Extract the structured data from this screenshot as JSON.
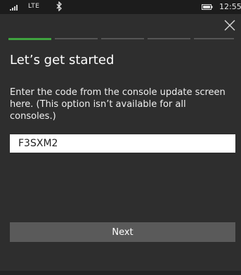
{
  "status_bar": {
    "network": "LTE",
    "time": "12:55",
    "icons": [
      "signal-icon",
      "bluetooth-icon",
      "battery-icon"
    ]
  },
  "header": {
    "close_icon": "close-icon"
  },
  "progress": {
    "total_steps": 5,
    "current_step": 1,
    "active_color": "#3fa33f",
    "inactive_color": "#555555"
  },
  "main": {
    "title": "Let’s get started",
    "instructions": "Enter the code from the console update screen here. (This option isn’t available for all consoles.)",
    "code_value": "F3SXM2",
    "next_label": "Next"
  },
  "colors": {
    "background": "#2e2e2e",
    "button": "#5a5a5a",
    "input_bg": "#ffffff"
  }
}
